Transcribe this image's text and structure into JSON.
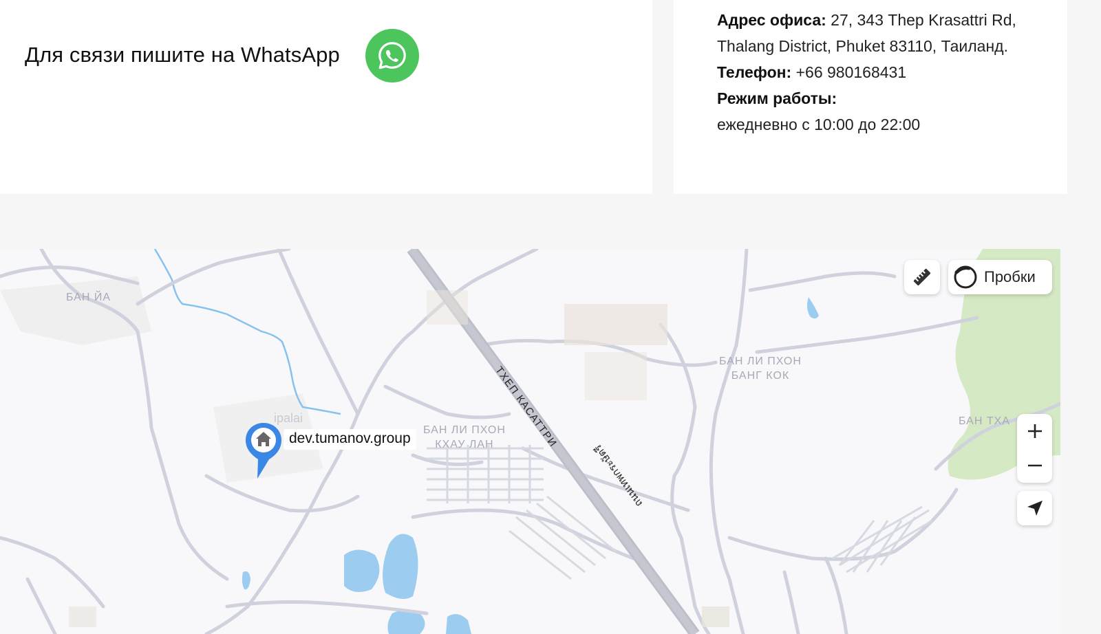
{
  "contact": {
    "whatsapp_text": "Для связи пишите на WhatsApp",
    "whatsapp_icon": "whatsapp-icon",
    "whatsapp_color": "#4cc55c"
  },
  "office": {
    "address_label": "Адрес офиса:",
    "address_value": "27, 343 Thep Krasattri Rd, Thalang District, Phuket 83110, Таиланд.",
    "phone_label": "Телефон:",
    "phone_value": "+66 980168431",
    "hours_label": "Режим работы:",
    "hours_value": "ежедневно с 10:00 до 22:00"
  },
  "map": {
    "marker_label": "dev.tumanov.group",
    "marker_color": "#3b87e6",
    "marker_icon": "home-icon",
    "poi_fragment": "ipalai",
    "places": {
      "ban_ia": "БАН ЙА",
      "ban_li_phon_bang_kok_1": "БАН ЛИ ПХОН",
      "ban_li_phon_bang_kok_2": "БАНГ КОК",
      "ban_li_phon_khau_lan_1": "БАН ЛИ ПХОН",
      "ban_li_phon_khau_lan_2": "КХАУ ЛАН",
      "ban_tha": "БАН ТХА"
    },
    "road_label": "ТХЕП КАСАТТРИ",
    "road_label_thai": "ถนนเทพกระษัตรี",
    "controls": {
      "ruler_icon": "ruler-icon",
      "traffic_label": "Пробки",
      "traffic_icon": "traffic-circle-icon",
      "zoom_in": "+",
      "zoom_out": "−",
      "locate_icon": "navigation-arrow-icon"
    }
  }
}
